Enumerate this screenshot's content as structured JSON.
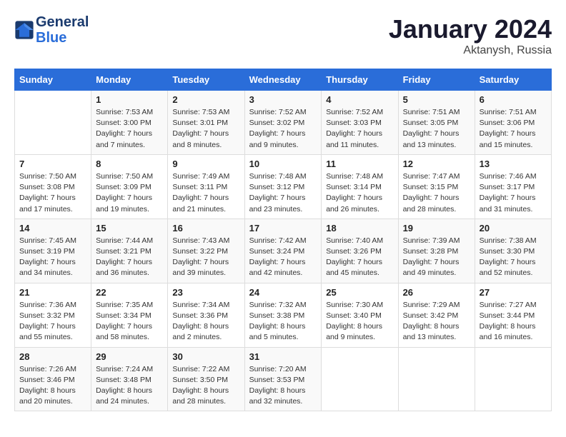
{
  "logo": {
    "line1": "General",
    "line2": "Blue"
  },
  "title": "January 2024",
  "subtitle": "Aktanysh, Russia",
  "header": {
    "days": [
      "Sunday",
      "Monday",
      "Tuesday",
      "Wednesday",
      "Thursday",
      "Friday",
      "Saturday"
    ]
  },
  "weeks": [
    [
      {
        "day": "",
        "info": ""
      },
      {
        "day": "1",
        "info": "Sunrise: 7:53 AM\nSunset: 3:00 PM\nDaylight: 7 hours\nand 7 minutes."
      },
      {
        "day": "2",
        "info": "Sunrise: 7:53 AM\nSunset: 3:01 PM\nDaylight: 7 hours\nand 8 minutes."
      },
      {
        "day": "3",
        "info": "Sunrise: 7:52 AM\nSunset: 3:02 PM\nDaylight: 7 hours\nand 9 minutes."
      },
      {
        "day": "4",
        "info": "Sunrise: 7:52 AM\nSunset: 3:03 PM\nDaylight: 7 hours\nand 11 minutes."
      },
      {
        "day": "5",
        "info": "Sunrise: 7:51 AM\nSunset: 3:05 PM\nDaylight: 7 hours\nand 13 minutes."
      },
      {
        "day": "6",
        "info": "Sunrise: 7:51 AM\nSunset: 3:06 PM\nDaylight: 7 hours\nand 15 minutes."
      }
    ],
    [
      {
        "day": "7",
        "info": "Sunrise: 7:50 AM\nSunset: 3:08 PM\nDaylight: 7 hours\nand 17 minutes."
      },
      {
        "day": "8",
        "info": "Sunrise: 7:50 AM\nSunset: 3:09 PM\nDaylight: 7 hours\nand 19 minutes."
      },
      {
        "day": "9",
        "info": "Sunrise: 7:49 AM\nSunset: 3:11 PM\nDaylight: 7 hours\nand 21 minutes."
      },
      {
        "day": "10",
        "info": "Sunrise: 7:48 AM\nSunset: 3:12 PM\nDaylight: 7 hours\nand 23 minutes."
      },
      {
        "day": "11",
        "info": "Sunrise: 7:48 AM\nSunset: 3:14 PM\nDaylight: 7 hours\nand 26 minutes."
      },
      {
        "day": "12",
        "info": "Sunrise: 7:47 AM\nSunset: 3:15 PM\nDaylight: 7 hours\nand 28 minutes."
      },
      {
        "day": "13",
        "info": "Sunrise: 7:46 AM\nSunset: 3:17 PM\nDaylight: 7 hours\nand 31 minutes."
      }
    ],
    [
      {
        "day": "14",
        "info": "Sunrise: 7:45 AM\nSunset: 3:19 PM\nDaylight: 7 hours\nand 34 minutes."
      },
      {
        "day": "15",
        "info": "Sunrise: 7:44 AM\nSunset: 3:21 PM\nDaylight: 7 hours\nand 36 minutes."
      },
      {
        "day": "16",
        "info": "Sunrise: 7:43 AM\nSunset: 3:22 PM\nDaylight: 7 hours\nand 39 minutes."
      },
      {
        "day": "17",
        "info": "Sunrise: 7:42 AM\nSunset: 3:24 PM\nDaylight: 7 hours\nand 42 minutes."
      },
      {
        "day": "18",
        "info": "Sunrise: 7:40 AM\nSunset: 3:26 PM\nDaylight: 7 hours\nand 45 minutes."
      },
      {
        "day": "19",
        "info": "Sunrise: 7:39 AM\nSunset: 3:28 PM\nDaylight: 7 hours\nand 49 minutes."
      },
      {
        "day": "20",
        "info": "Sunrise: 7:38 AM\nSunset: 3:30 PM\nDaylight: 7 hours\nand 52 minutes."
      }
    ],
    [
      {
        "day": "21",
        "info": "Sunrise: 7:36 AM\nSunset: 3:32 PM\nDaylight: 7 hours\nand 55 minutes."
      },
      {
        "day": "22",
        "info": "Sunrise: 7:35 AM\nSunset: 3:34 PM\nDaylight: 7 hours\nand 58 minutes."
      },
      {
        "day": "23",
        "info": "Sunrise: 7:34 AM\nSunset: 3:36 PM\nDaylight: 8 hours\nand 2 minutes."
      },
      {
        "day": "24",
        "info": "Sunrise: 7:32 AM\nSunset: 3:38 PM\nDaylight: 8 hours\nand 5 minutes."
      },
      {
        "day": "25",
        "info": "Sunrise: 7:30 AM\nSunset: 3:40 PM\nDaylight: 8 hours\nand 9 minutes."
      },
      {
        "day": "26",
        "info": "Sunrise: 7:29 AM\nSunset: 3:42 PM\nDaylight: 8 hours\nand 13 minutes."
      },
      {
        "day": "27",
        "info": "Sunrise: 7:27 AM\nSunset: 3:44 PM\nDaylight: 8 hours\nand 16 minutes."
      }
    ],
    [
      {
        "day": "28",
        "info": "Sunrise: 7:26 AM\nSunset: 3:46 PM\nDaylight: 8 hours\nand 20 minutes."
      },
      {
        "day": "29",
        "info": "Sunrise: 7:24 AM\nSunset: 3:48 PM\nDaylight: 8 hours\nand 24 minutes."
      },
      {
        "day": "30",
        "info": "Sunrise: 7:22 AM\nSunset: 3:50 PM\nDaylight: 8 hours\nand 28 minutes."
      },
      {
        "day": "31",
        "info": "Sunrise: 7:20 AM\nSunset: 3:53 PM\nDaylight: 8 hours\nand 32 minutes."
      },
      {
        "day": "",
        "info": ""
      },
      {
        "day": "",
        "info": ""
      },
      {
        "day": "",
        "info": ""
      }
    ]
  ]
}
